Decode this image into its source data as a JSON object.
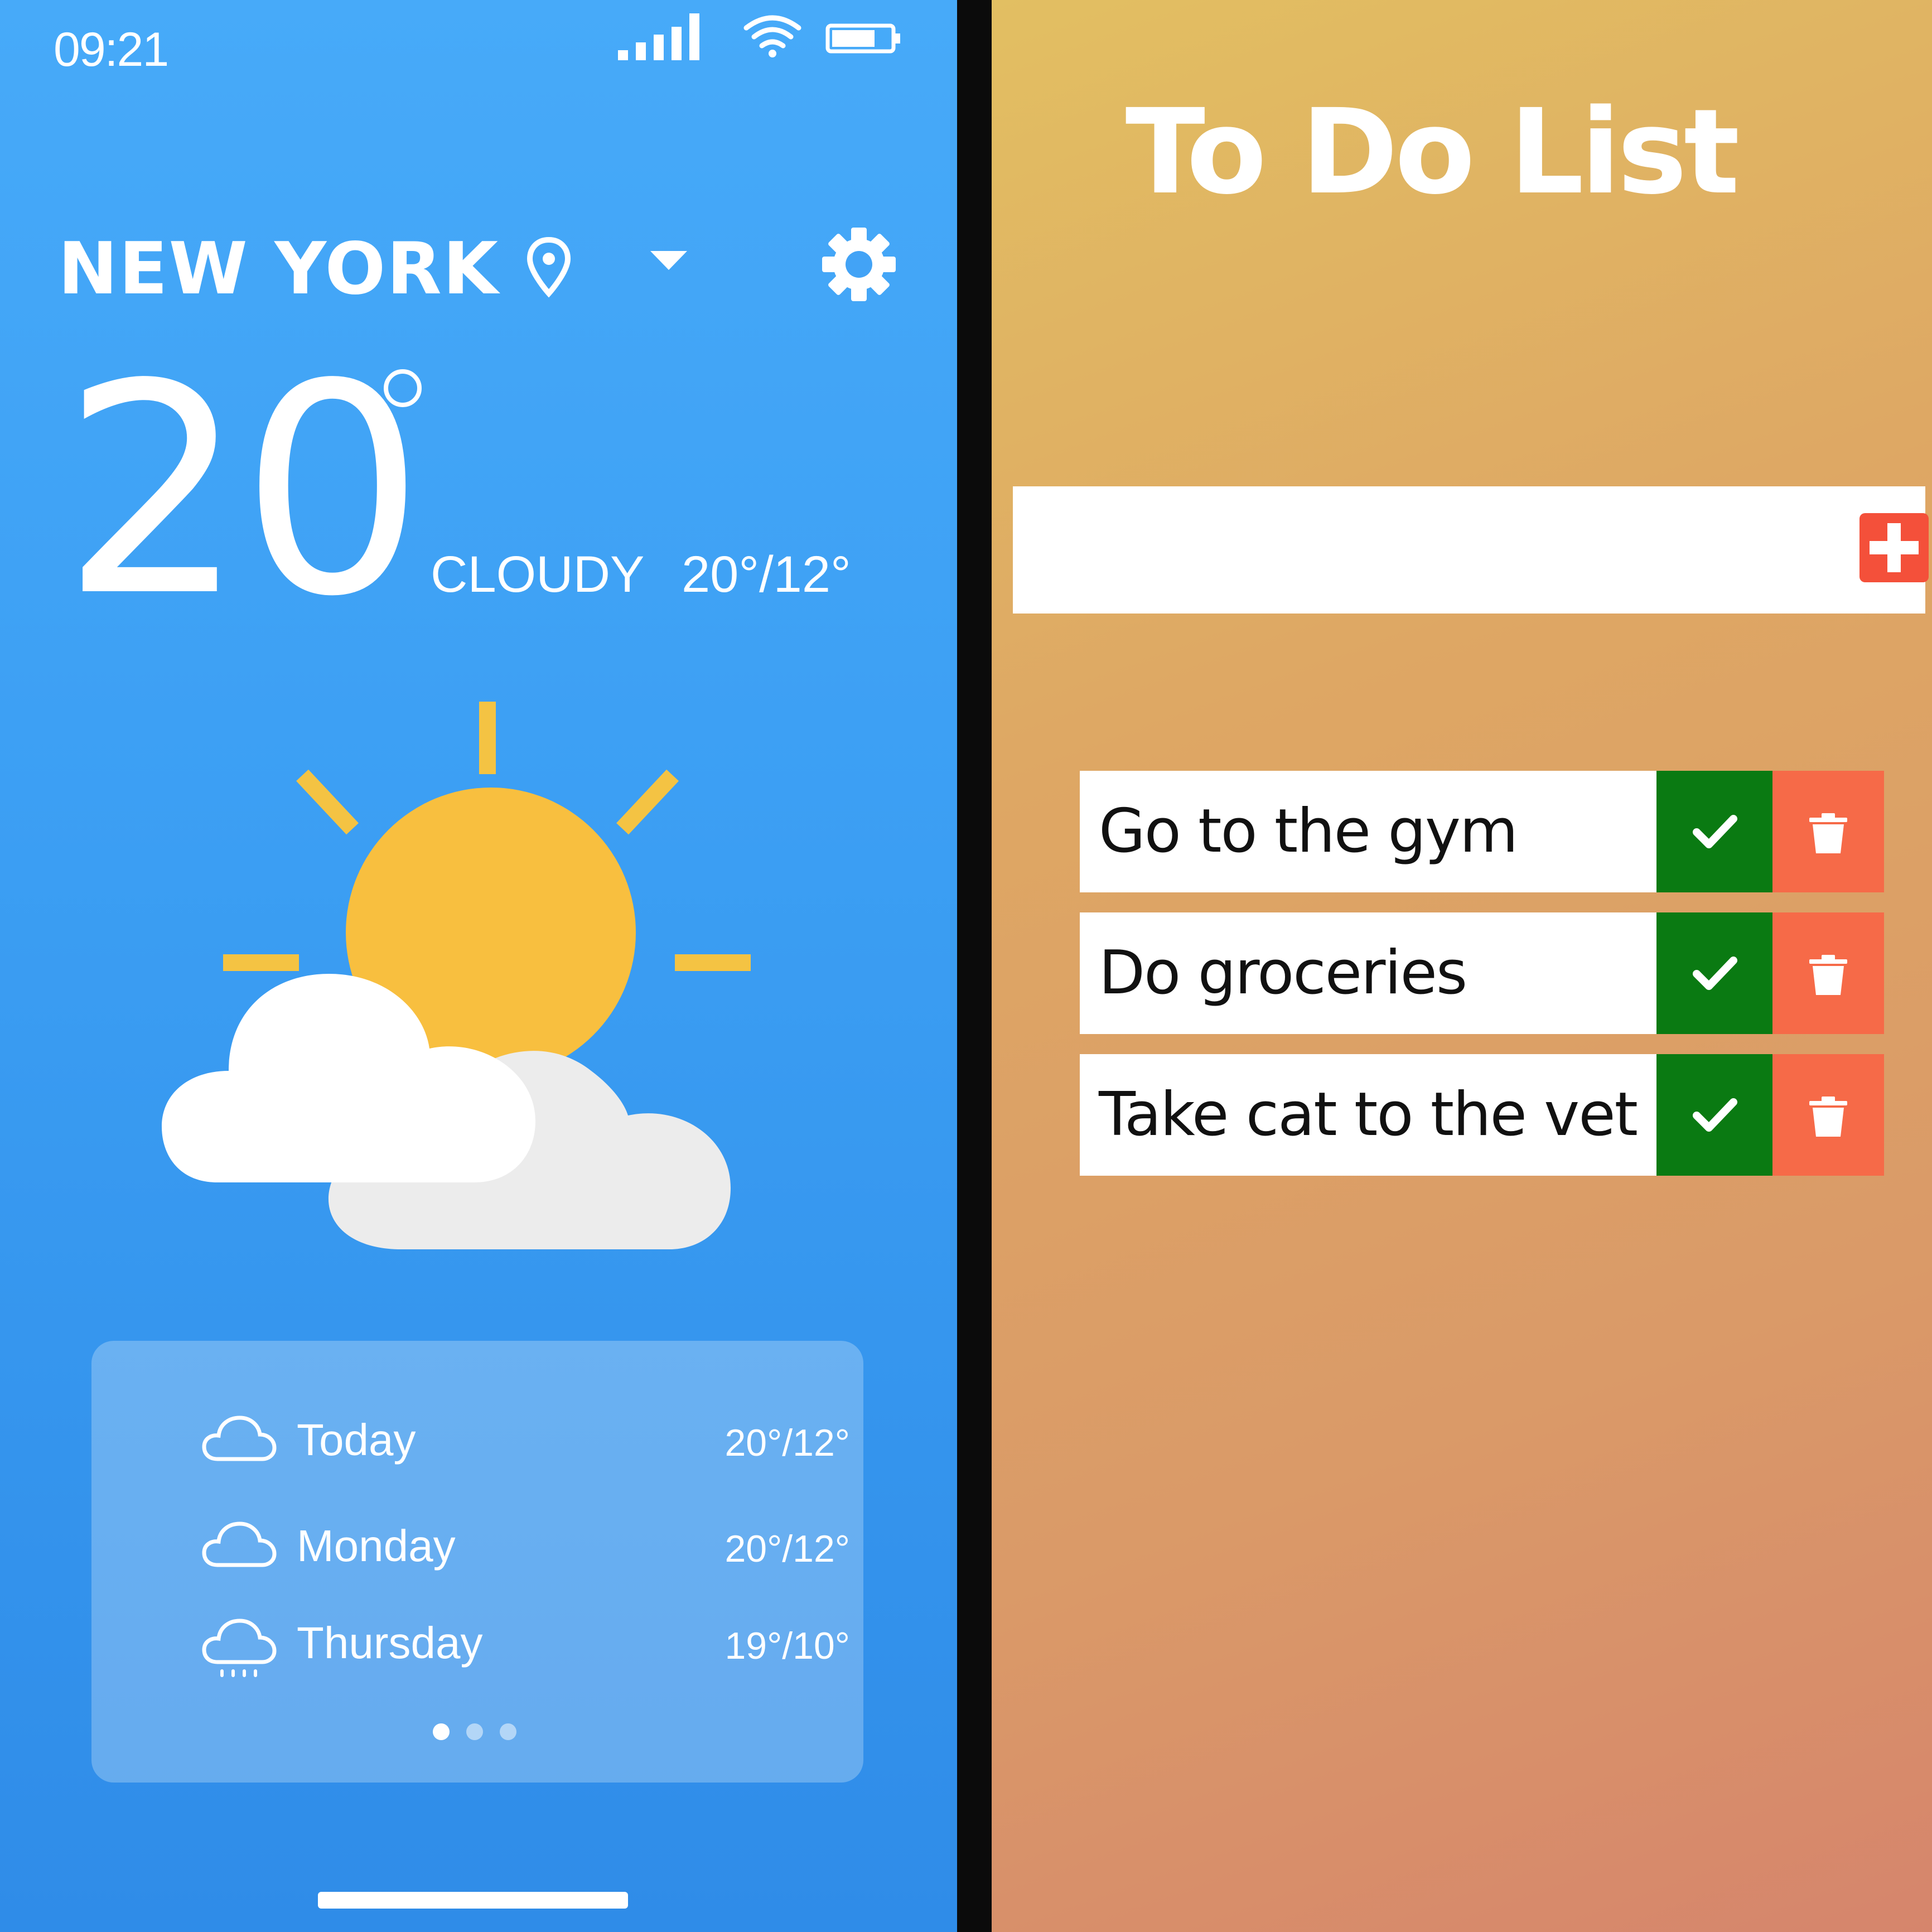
{
  "weather_app": {
    "status_bar": {
      "time": "09:21",
      "icons": [
        "signal-icon",
        "wifi-icon",
        "battery-icon"
      ]
    },
    "location": {
      "city": "NEW YORK",
      "icons": [
        "location-pin-icon",
        "chevron-down-icon"
      ]
    },
    "current": {
      "temperature": "20",
      "condition": "CLOUDY",
      "range": "20°/12°",
      "icon": "partly-cloudy-icon"
    },
    "forecast": [
      {
        "day": "Today",
        "range": "20°/12°",
        "icon": "cloud-icon"
      },
      {
        "day": "Monday",
        "range": "20°/12°",
        "icon": "cloud-icon"
      },
      {
        "day": "Thursday",
        "range": "19°/10°",
        "icon": "cloud-rain-icon"
      }
    ],
    "pagination": {
      "pages": 3,
      "active": 1
    },
    "colors": {
      "background": "#3b9ef3",
      "sun": "#f9bd3e",
      "text": "#ffffff"
    }
  },
  "todo_app": {
    "title": "To Do List",
    "input": {
      "value": "",
      "placeholder": ""
    },
    "add_icon": "plus-icon",
    "tasks": [
      {
        "text": "Go to the gym"
      },
      {
        "text": "Do groceries"
      },
      {
        "text": "Take cat to the vet"
      }
    ],
    "colors": {
      "complete": "#0a7a12",
      "delete": "#f66a48",
      "add": "#f4503a"
    }
  }
}
